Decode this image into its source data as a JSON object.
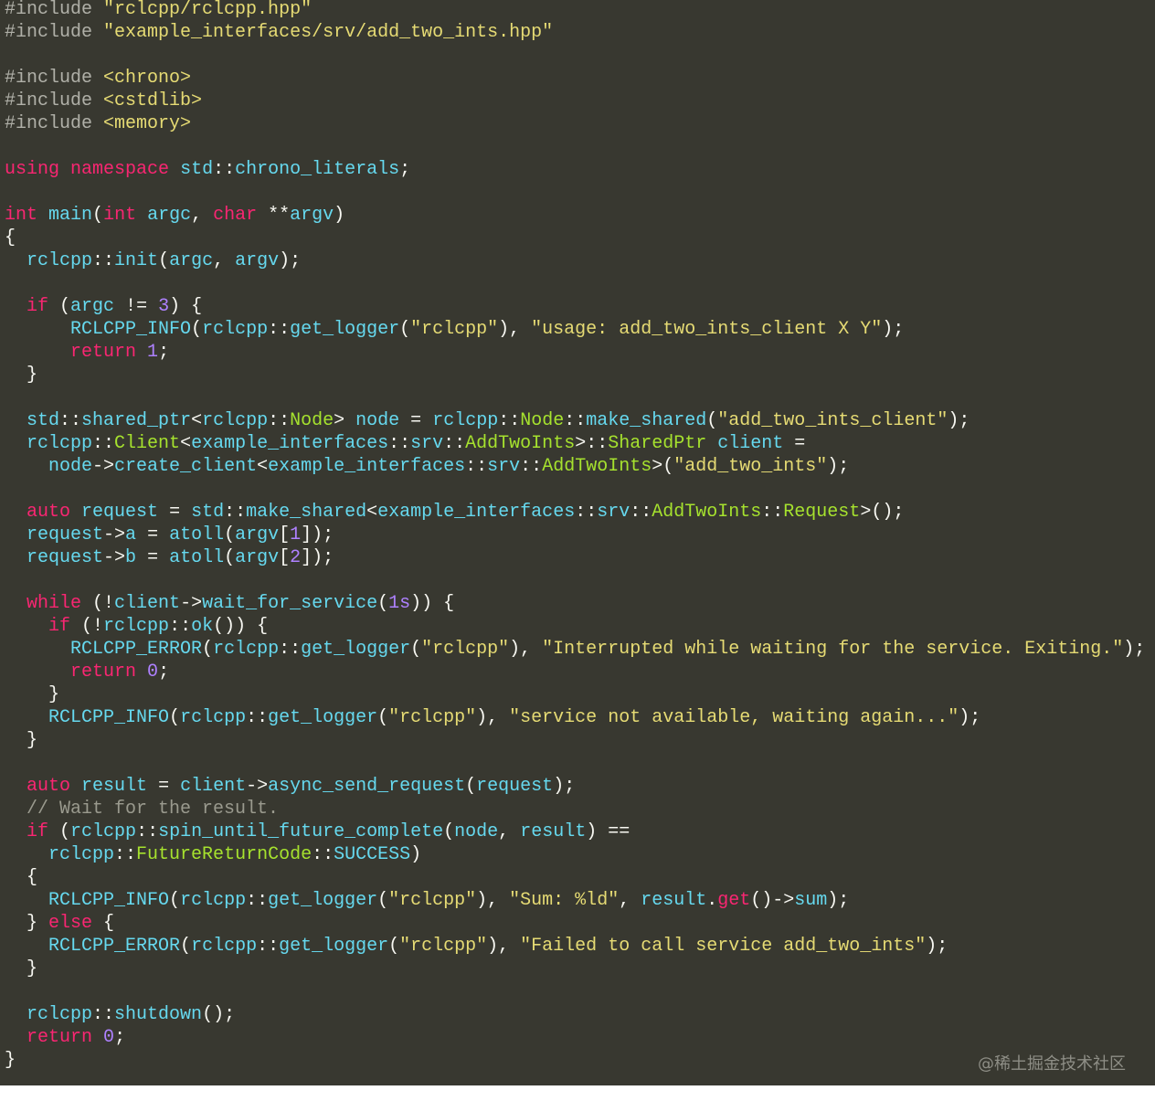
{
  "colors": {
    "background": "#383830",
    "preprocessor": "#b0b0a8",
    "string": "#e6db74",
    "keyword": "#f92672",
    "identifier": "#66d9ef",
    "operator": "#f8f8f2",
    "number": "#ae81ff",
    "type": "#a6e22e",
    "comment": "#9a9a8e"
  },
  "watermark": "@稀土掘金技术社区",
  "lines": [
    [
      [
        "pp",
        "#include "
      ],
      [
        "str",
        "\"rclcpp/rclcpp.hpp\""
      ]
    ],
    [
      [
        "pp",
        "#include "
      ],
      [
        "str",
        "\"example_interfaces/srv/add_two_ints.hpp\""
      ]
    ],
    [],
    [
      [
        "pp",
        "#include "
      ],
      [
        "str",
        "<chrono>"
      ]
    ],
    [
      [
        "pp",
        "#include "
      ],
      [
        "str",
        "<cstdlib>"
      ]
    ],
    [
      [
        "pp",
        "#include "
      ],
      [
        "str",
        "<memory>"
      ]
    ],
    [],
    [
      [
        "kw",
        "using"
      ],
      [
        "op",
        " "
      ],
      [
        "kw",
        "namespace"
      ],
      [
        "op",
        " "
      ],
      [
        "id",
        "std"
      ],
      [
        "op",
        "::"
      ],
      [
        "id",
        "chrono_literals"
      ],
      [
        "op",
        ";"
      ]
    ],
    [],
    [
      [
        "kw",
        "int"
      ],
      [
        "op",
        " "
      ],
      [
        "id",
        "main"
      ],
      [
        "op",
        "("
      ],
      [
        "kw",
        "int"
      ],
      [
        "op",
        " "
      ],
      [
        "id",
        "argc"
      ],
      [
        "op",
        ", "
      ],
      [
        "kw",
        "char"
      ],
      [
        "op",
        " **"
      ],
      [
        "id",
        "argv"
      ],
      [
        "op",
        ")"
      ]
    ],
    [
      [
        "op",
        "{"
      ]
    ],
    [
      [
        "op",
        "  "
      ],
      [
        "id",
        "rclcpp"
      ],
      [
        "op",
        "::"
      ],
      [
        "id",
        "init"
      ],
      [
        "op",
        "("
      ],
      [
        "id",
        "argc"
      ],
      [
        "op",
        ", "
      ],
      [
        "id",
        "argv"
      ],
      [
        "op",
        ");"
      ]
    ],
    [],
    [
      [
        "op",
        "  "
      ],
      [
        "kw",
        "if"
      ],
      [
        "op",
        " ("
      ],
      [
        "id",
        "argc"
      ],
      [
        "op",
        " != "
      ],
      [
        "num",
        "3"
      ],
      [
        "op",
        ") {"
      ]
    ],
    [
      [
        "op",
        "      "
      ],
      [
        "id",
        "RCLCPP_INFO"
      ],
      [
        "op",
        "("
      ],
      [
        "id",
        "rclcpp"
      ],
      [
        "op",
        "::"
      ],
      [
        "id",
        "get_logger"
      ],
      [
        "op",
        "("
      ],
      [
        "str",
        "\"rclcpp\""
      ],
      [
        "op",
        "), "
      ],
      [
        "str",
        "\"usage: add_two_ints_client X Y\""
      ],
      [
        "op",
        ");"
      ]
    ],
    [
      [
        "op",
        "      "
      ],
      [
        "kw",
        "return"
      ],
      [
        "op",
        " "
      ],
      [
        "num",
        "1"
      ],
      [
        "op",
        ";"
      ]
    ],
    [
      [
        "op",
        "  }"
      ]
    ],
    [],
    [
      [
        "op",
        "  "
      ],
      [
        "id",
        "std"
      ],
      [
        "op",
        "::"
      ],
      [
        "id",
        "shared_ptr"
      ],
      [
        "op",
        "<"
      ],
      [
        "id",
        "rclcpp"
      ],
      [
        "op",
        "::"
      ],
      [
        "type",
        "Node"
      ],
      [
        "op",
        "> "
      ],
      [
        "id",
        "node"
      ],
      [
        "op",
        " = "
      ],
      [
        "id",
        "rclcpp"
      ],
      [
        "op",
        "::"
      ],
      [
        "type",
        "Node"
      ],
      [
        "op",
        "::"
      ],
      [
        "id",
        "make_shared"
      ],
      [
        "op",
        "("
      ],
      [
        "str",
        "\"add_two_ints_client\""
      ],
      [
        "op",
        ");"
      ]
    ],
    [
      [
        "op",
        "  "
      ],
      [
        "id",
        "rclcpp"
      ],
      [
        "op",
        "::"
      ],
      [
        "type",
        "Client"
      ],
      [
        "op",
        "<"
      ],
      [
        "id",
        "example_interfaces"
      ],
      [
        "op",
        "::"
      ],
      [
        "id",
        "srv"
      ],
      [
        "op",
        "::"
      ],
      [
        "type",
        "AddTwoInts"
      ],
      [
        "op",
        ">::"
      ],
      [
        "type",
        "SharedPtr"
      ],
      [
        "op",
        " "
      ],
      [
        "id",
        "client"
      ],
      [
        "op",
        " ="
      ]
    ],
    [
      [
        "op",
        "    "
      ],
      [
        "id",
        "node"
      ],
      [
        "op",
        "->"
      ],
      [
        "id",
        "create_client"
      ],
      [
        "op",
        "<"
      ],
      [
        "id",
        "example_interfaces"
      ],
      [
        "op",
        "::"
      ],
      [
        "id",
        "srv"
      ],
      [
        "op",
        "::"
      ],
      [
        "type",
        "AddTwoInts"
      ],
      [
        "op",
        ">("
      ],
      [
        "str",
        "\"add_two_ints\""
      ],
      [
        "op",
        ");"
      ]
    ],
    [],
    [
      [
        "op",
        "  "
      ],
      [
        "kw",
        "auto"
      ],
      [
        "op",
        " "
      ],
      [
        "id",
        "request"
      ],
      [
        "op",
        " = "
      ],
      [
        "id",
        "std"
      ],
      [
        "op",
        "::"
      ],
      [
        "id",
        "make_shared"
      ],
      [
        "op",
        "<"
      ],
      [
        "id",
        "example_interfaces"
      ],
      [
        "op",
        "::"
      ],
      [
        "id",
        "srv"
      ],
      [
        "op",
        "::"
      ],
      [
        "type",
        "AddTwoInts"
      ],
      [
        "op",
        "::"
      ],
      [
        "type",
        "Request"
      ],
      [
        "op",
        ">();"
      ]
    ],
    [
      [
        "op",
        "  "
      ],
      [
        "id",
        "request"
      ],
      [
        "op",
        "->"
      ],
      [
        "id",
        "a"
      ],
      [
        "op",
        " = "
      ],
      [
        "id",
        "atoll"
      ],
      [
        "op",
        "("
      ],
      [
        "id",
        "argv"
      ],
      [
        "op",
        "["
      ],
      [
        "num",
        "1"
      ],
      [
        "op",
        "]);"
      ]
    ],
    [
      [
        "op",
        "  "
      ],
      [
        "id",
        "request"
      ],
      [
        "op",
        "->"
      ],
      [
        "id",
        "b"
      ],
      [
        "op",
        " = "
      ],
      [
        "id",
        "atoll"
      ],
      [
        "op",
        "("
      ],
      [
        "id",
        "argv"
      ],
      [
        "op",
        "["
      ],
      [
        "num",
        "2"
      ],
      [
        "op",
        "]);"
      ]
    ],
    [],
    [
      [
        "op",
        "  "
      ],
      [
        "kw",
        "while"
      ],
      [
        "op",
        " (!"
      ],
      [
        "id",
        "client"
      ],
      [
        "op",
        "->"
      ],
      [
        "id",
        "wait_for_service"
      ],
      [
        "op",
        "("
      ],
      [
        "num",
        "1s"
      ],
      [
        "op",
        ")) {"
      ]
    ],
    [
      [
        "op",
        "    "
      ],
      [
        "kw",
        "if"
      ],
      [
        "op",
        " (!"
      ],
      [
        "id",
        "rclcpp"
      ],
      [
        "op",
        "::"
      ],
      [
        "id",
        "ok"
      ],
      [
        "op",
        "()) {"
      ]
    ],
    [
      [
        "op",
        "      "
      ],
      [
        "id",
        "RCLCPP_ERROR"
      ],
      [
        "op",
        "("
      ],
      [
        "id",
        "rclcpp"
      ],
      [
        "op",
        "::"
      ],
      [
        "id",
        "get_logger"
      ],
      [
        "op",
        "("
      ],
      [
        "str",
        "\"rclcpp\""
      ],
      [
        "op",
        "), "
      ],
      [
        "str",
        "\"Interrupted while waiting for the service. Exiting.\""
      ],
      [
        "op",
        ");"
      ]
    ],
    [
      [
        "op",
        "      "
      ],
      [
        "kw",
        "return"
      ],
      [
        "op",
        " "
      ],
      [
        "num",
        "0"
      ],
      [
        "op",
        ";"
      ]
    ],
    [
      [
        "op",
        "    }"
      ]
    ],
    [
      [
        "op",
        "    "
      ],
      [
        "id",
        "RCLCPP_INFO"
      ],
      [
        "op",
        "("
      ],
      [
        "id",
        "rclcpp"
      ],
      [
        "op",
        "::"
      ],
      [
        "id",
        "get_logger"
      ],
      [
        "op",
        "("
      ],
      [
        "str",
        "\"rclcpp\""
      ],
      [
        "op",
        "), "
      ],
      [
        "str",
        "\"service not available, waiting again...\""
      ],
      [
        "op",
        ");"
      ]
    ],
    [
      [
        "op",
        "  }"
      ]
    ],
    [],
    [
      [
        "op",
        "  "
      ],
      [
        "kw",
        "auto"
      ],
      [
        "op",
        " "
      ],
      [
        "id",
        "result"
      ],
      [
        "op",
        " = "
      ],
      [
        "id",
        "client"
      ],
      [
        "op",
        "->"
      ],
      [
        "id",
        "async_send_request"
      ],
      [
        "op",
        "("
      ],
      [
        "id",
        "request"
      ],
      [
        "op",
        ");"
      ]
    ],
    [
      [
        "op",
        "  "
      ],
      [
        "cmt",
        "// Wait for the result."
      ]
    ],
    [
      [
        "op",
        "  "
      ],
      [
        "kw",
        "if"
      ],
      [
        "op",
        " ("
      ],
      [
        "id",
        "rclcpp"
      ],
      [
        "op",
        "::"
      ],
      [
        "id",
        "spin_until_future_complete"
      ],
      [
        "op",
        "("
      ],
      [
        "id",
        "node"
      ],
      [
        "op",
        ", "
      ],
      [
        "id",
        "result"
      ],
      [
        "op",
        ") =="
      ]
    ],
    [
      [
        "op",
        "    "
      ],
      [
        "id",
        "rclcpp"
      ],
      [
        "op",
        "::"
      ],
      [
        "type",
        "FutureReturnCode"
      ],
      [
        "op",
        "::"
      ],
      [
        "id",
        "SUCCESS"
      ],
      [
        "op",
        ")"
      ]
    ],
    [
      [
        "op",
        "  {"
      ]
    ],
    [
      [
        "op",
        "    "
      ],
      [
        "id",
        "RCLCPP_INFO"
      ],
      [
        "op",
        "("
      ],
      [
        "id",
        "rclcpp"
      ],
      [
        "op",
        "::"
      ],
      [
        "id",
        "get_logger"
      ],
      [
        "op",
        "("
      ],
      [
        "str",
        "\"rclcpp\""
      ],
      [
        "op",
        "), "
      ],
      [
        "str",
        "\"Sum: %ld\""
      ],
      [
        "op",
        ", "
      ],
      [
        "id",
        "result"
      ],
      [
        "op",
        "."
      ],
      [
        "kw",
        "get"
      ],
      [
        "op",
        "()->"
      ],
      [
        "id",
        "sum"
      ],
      [
        "op",
        ");"
      ]
    ],
    [
      [
        "op",
        "  } "
      ],
      [
        "kw",
        "else"
      ],
      [
        "op",
        " {"
      ]
    ],
    [
      [
        "op",
        "    "
      ],
      [
        "id",
        "RCLCPP_ERROR"
      ],
      [
        "op",
        "("
      ],
      [
        "id",
        "rclcpp"
      ],
      [
        "op",
        "::"
      ],
      [
        "id",
        "get_logger"
      ],
      [
        "op",
        "("
      ],
      [
        "str",
        "\"rclcpp\""
      ],
      [
        "op",
        "), "
      ],
      [
        "str",
        "\"Failed to call service add_two_ints\""
      ],
      [
        "op",
        ");"
      ]
    ],
    [
      [
        "op",
        "  }"
      ]
    ],
    [],
    [
      [
        "op",
        "  "
      ],
      [
        "id",
        "rclcpp"
      ],
      [
        "op",
        "::"
      ],
      [
        "id",
        "shutdown"
      ],
      [
        "op",
        "();"
      ]
    ],
    [
      [
        "op",
        "  "
      ],
      [
        "kw",
        "return"
      ],
      [
        "op",
        " "
      ],
      [
        "num",
        "0"
      ],
      [
        "op",
        ";"
      ]
    ],
    [
      [
        "op",
        "}"
      ]
    ]
  ]
}
